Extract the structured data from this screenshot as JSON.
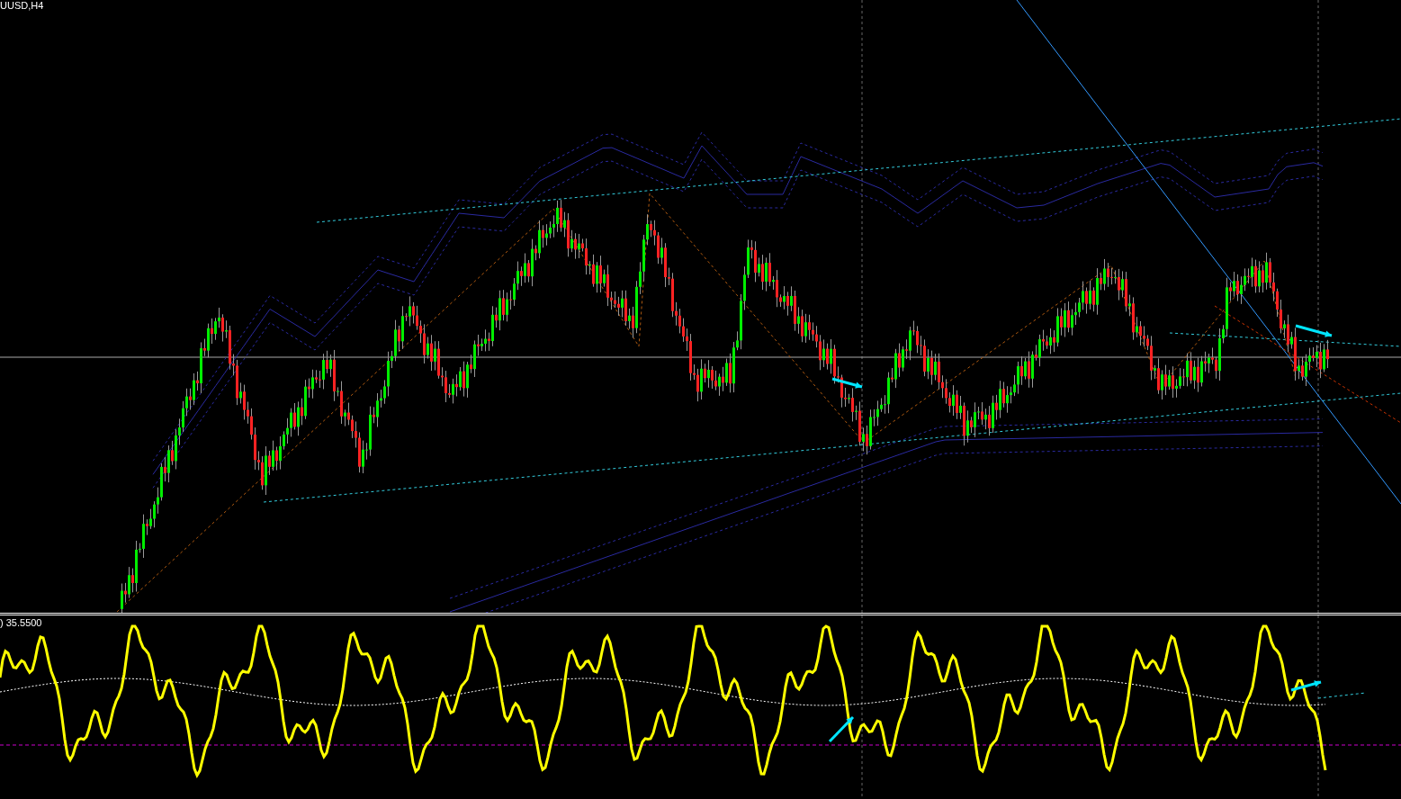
{
  "chart": {
    "title": "UUSD,H4"
  },
  "indicator": {
    "label": ") 35.5500"
  }
}
